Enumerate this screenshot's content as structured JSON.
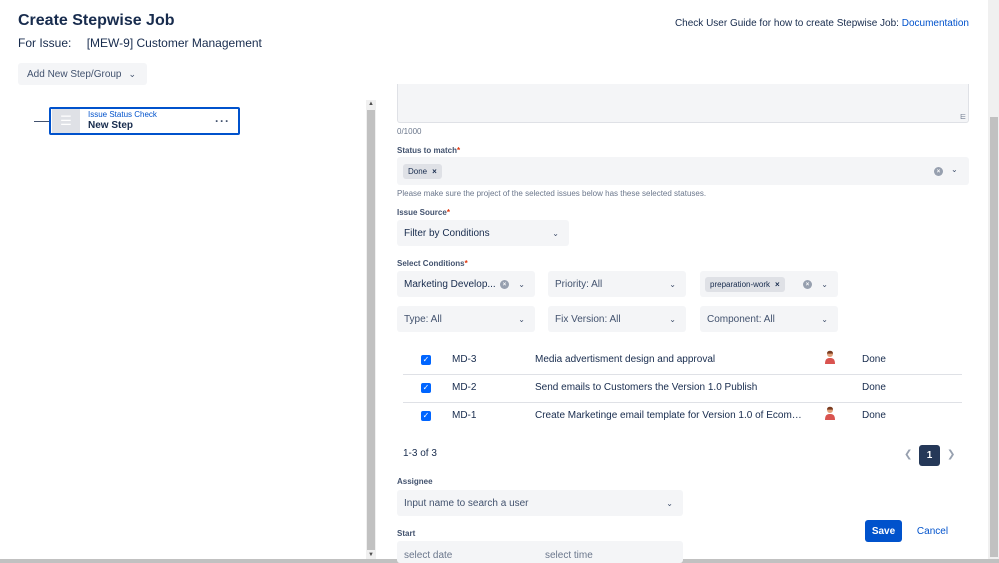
{
  "header": {
    "title": "Create Stepwise Job",
    "issue_label": "For Issue:",
    "issue_value": "[MEW-9] Customer Management",
    "guide_text": "Check User Guide for how to create Stepwise Job:",
    "guide_link": "Documentation"
  },
  "toolbar": {
    "add_step_label": "Add New Step/Group"
  },
  "tree": {
    "step_type": "Issue Status Check",
    "step_name": "New Step",
    "more_label": "···"
  },
  "form": {
    "char_count": "0/1000",
    "status_label": "Status to match",
    "status_chip": "Done",
    "status_helper": "Please make sure the project of the selected issues below has these selected statuses.",
    "issue_source_label": "Issue Source",
    "issue_source_value": "Filter by Conditions",
    "conditions_label": "Select Conditions",
    "filters": {
      "project": "Marketing Develop...",
      "priority": "Priority: All",
      "label_chip": "preparation-work",
      "type": "Type: All",
      "fix_version": "Fix Version: All",
      "component": "Component: All"
    },
    "required_mark": "*"
  },
  "issues": [
    {
      "key": "MD-3",
      "summary": "Media advertisment design and approval",
      "status": "Done",
      "has_avatar": true
    },
    {
      "key": "MD-2",
      "summary": "Send emails to Customers the Version 1.0 Publish",
      "status": "Done",
      "has_avatar": false
    },
    {
      "key": "MD-1",
      "summary": "Create Marketinge email template for Version 1.0 of Ecomme...",
      "status": "Done",
      "has_avatar": true
    }
  ],
  "pagination": {
    "summary": "1-3 of 3",
    "current_page": "1"
  },
  "assignee": {
    "label": "Assignee",
    "placeholder": "Input name to search a user"
  },
  "start": {
    "label": "Start",
    "date_placeholder": "select date",
    "time_placeholder": "select time"
  },
  "actions": {
    "save_label": "Save",
    "cancel_label": "Cancel"
  },
  "colors": {
    "primary": "#0052cc",
    "required": "#de350b",
    "checkbox": "#0065ff"
  }
}
